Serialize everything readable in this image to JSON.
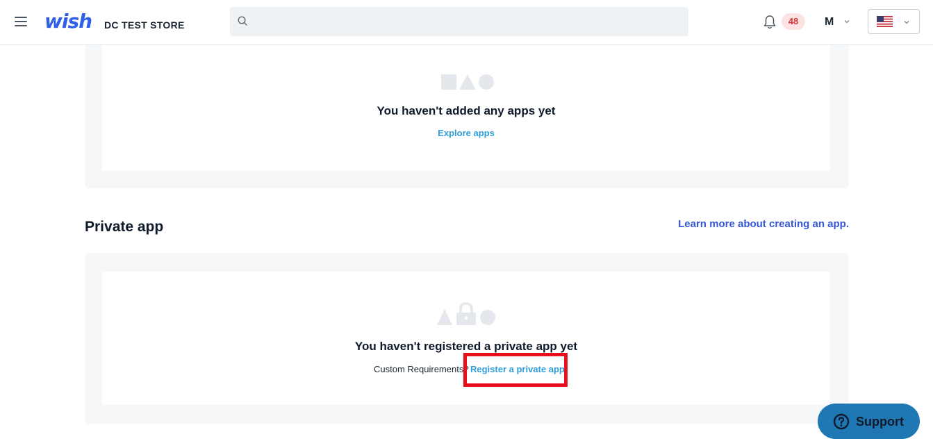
{
  "header": {
    "logo_text": "wish",
    "store_name": "DC TEST STORE",
    "search_placeholder": "",
    "notification_count": "48",
    "account_initial": "M"
  },
  "added_apps": {
    "empty_title": "You haven't added any apps yet",
    "explore_link": "Explore apps"
  },
  "private_app": {
    "section_title": "Private app",
    "learn_more_link": "Learn more about creating an app.",
    "empty_title": "You haven't registered a private app yet",
    "custom_text": "Custom Requirements?",
    "register_link": "Register a private app"
  },
  "support": {
    "label": "Support"
  },
  "colors": {
    "brand_blue": "#2f5fe8",
    "link_blue": "#2d9ed8",
    "highlight_red": "#e8101c",
    "support_bg": "#1f77b4"
  }
}
